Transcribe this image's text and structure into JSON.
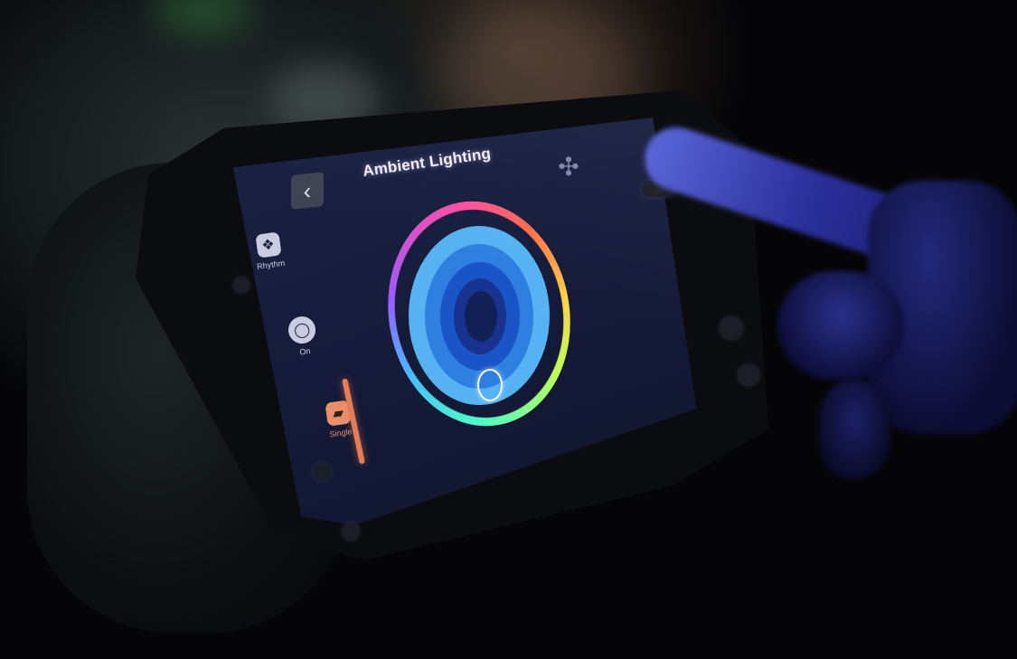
{
  "screen": {
    "title": "Ambient Lighting",
    "back_glyph": "‹",
    "settings_glyph": "✣"
  },
  "sidebar": {
    "items": [
      {
        "label": "Rhythm",
        "icon": "light-bulb-icon",
        "glyph": "❖",
        "selected": false
      },
      {
        "label": "On",
        "icon": "power-icon",
        "glyph": "◯",
        "selected": false
      },
      {
        "label": "Single",
        "icon": "seat-icon",
        "glyph": "▰",
        "selected": true
      }
    ]
  },
  "color_wheel": {
    "selected_color": "#56b2f2",
    "ring_colors": [
      "#ff4da6",
      "#ff6c4a",
      "#ffd24a",
      "#baff5a",
      "#4dffc9",
      "#4ab7ff",
      "#9a5aff"
    ]
  },
  "colors": {
    "accent": "#e47d58",
    "screen_bg": "#171d3b"
  }
}
